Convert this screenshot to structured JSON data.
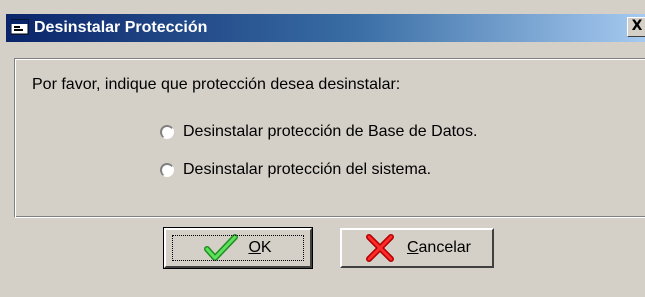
{
  "window": {
    "title": "Desinstalar Protección",
    "close_glyph": "X",
    "title_icon": "application-icon"
  },
  "dialog": {
    "prompt": "Por favor, indique que protección desea desinstalar:",
    "options": [
      {
        "label": "Desinstalar protección de Base de Datos.",
        "selected": false
      },
      {
        "label": "Desinstalar protección del sistema.",
        "selected": false
      }
    ]
  },
  "buttons": {
    "ok": {
      "mnemonic": "O",
      "rest": "K",
      "icon": "checkmark-icon",
      "icon_color": "#2db82d"
    },
    "cancel": {
      "mnemonic": "C",
      "rest": "ancelar",
      "icon": "x-icon",
      "icon_color": "#e01010"
    }
  },
  "colors": {
    "titlebar_start": "#0a246a",
    "titlebar_end": "#a6caf0",
    "face": "#d4d0c8"
  }
}
